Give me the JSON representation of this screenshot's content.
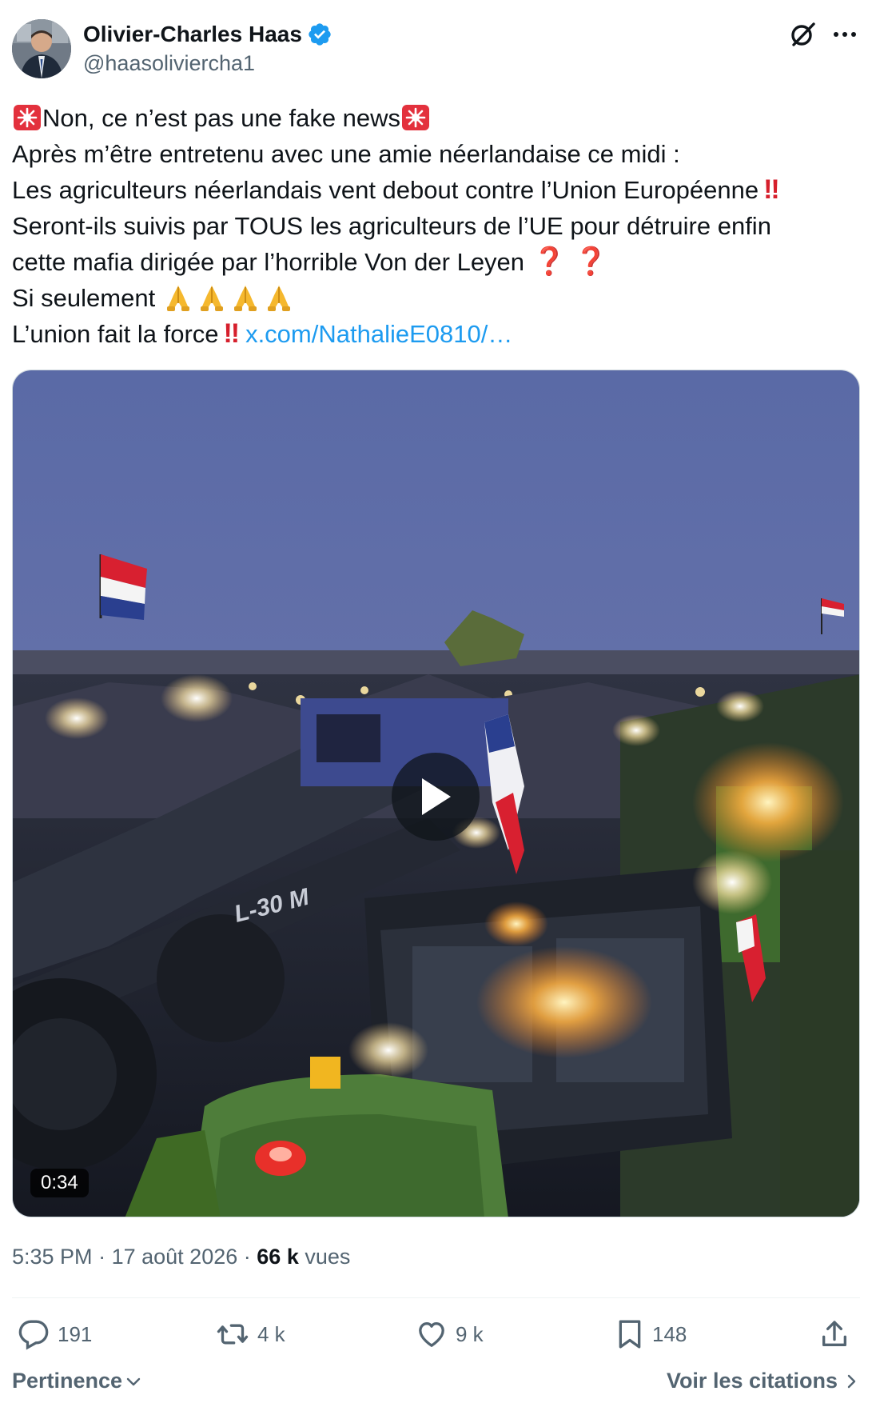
{
  "author": {
    "display_name": "Olivier-Charles Haas",
    "handle": "@haasoliviercha1",
    "verified": true
  },
  "icons": {
    "verified": "verified-badge-icon",
    "grok": "grok-icon",
    "more": "more-icon",
    "siren": "rotating-light-emoji",
    "double_bang": "double-exclamation-emoji",
    "question": "red-question-emoji",
    "pray": "folded-hands-emoji",
    "play": "play-icon",
    "reply": "reply-icon",
    "repost": "repost-icon",
    "like": "like-icon",
    "bookmark": "bookmark-icon",
    "share": "share-icon"
  },
  "tweet": {
    "line1": "Non, ce n’est pas une fake news",
    "line2": "Après m’être entretenu avec une amie néerlandaise ce midi :",
    "line3": "Les agriculteurs néerlandais vent debout contre l’Union Européenne",
    "line4": "Seront-ils suivis par TOUS les agriculteurs de l’UE pour détruire enfin",
    "line5": "cette mafia dirigée par l’horrible Von der Leyen",
    "line6": "Si seulement",
    "line7": "L’union fait la force",
    "link": "x.com/NathalieE0810/…",
    "double_bang": "‼",
    "question_mark": "❓"
  },
  "media": {
    "duration": "0:34",
    "vehicle_text": "L-30 M"
  },
  "meta": {
    "time": "5:35 PM",
    "separator": "·",
    "date": "17 août 2026",
    "views_count": "66 k",
    "views_label": "vues"
  },
  "actions": {
    "replies": "191",
    "reposts": "4 k",
    "likes": "9 k",
    "bookmarks": "148"
  },
  "footer": {
    "sort_label": "Pertinence",
    "quotes_label": "Voir les citations"
  },
  "colors": {
    "text": "#0f1419",
    "secondary": "#536471",
    "link": "#1d9bf0",
    "verified": "#1d9bf0",
    "emoji_red": "#d61f2c"
  }
}
